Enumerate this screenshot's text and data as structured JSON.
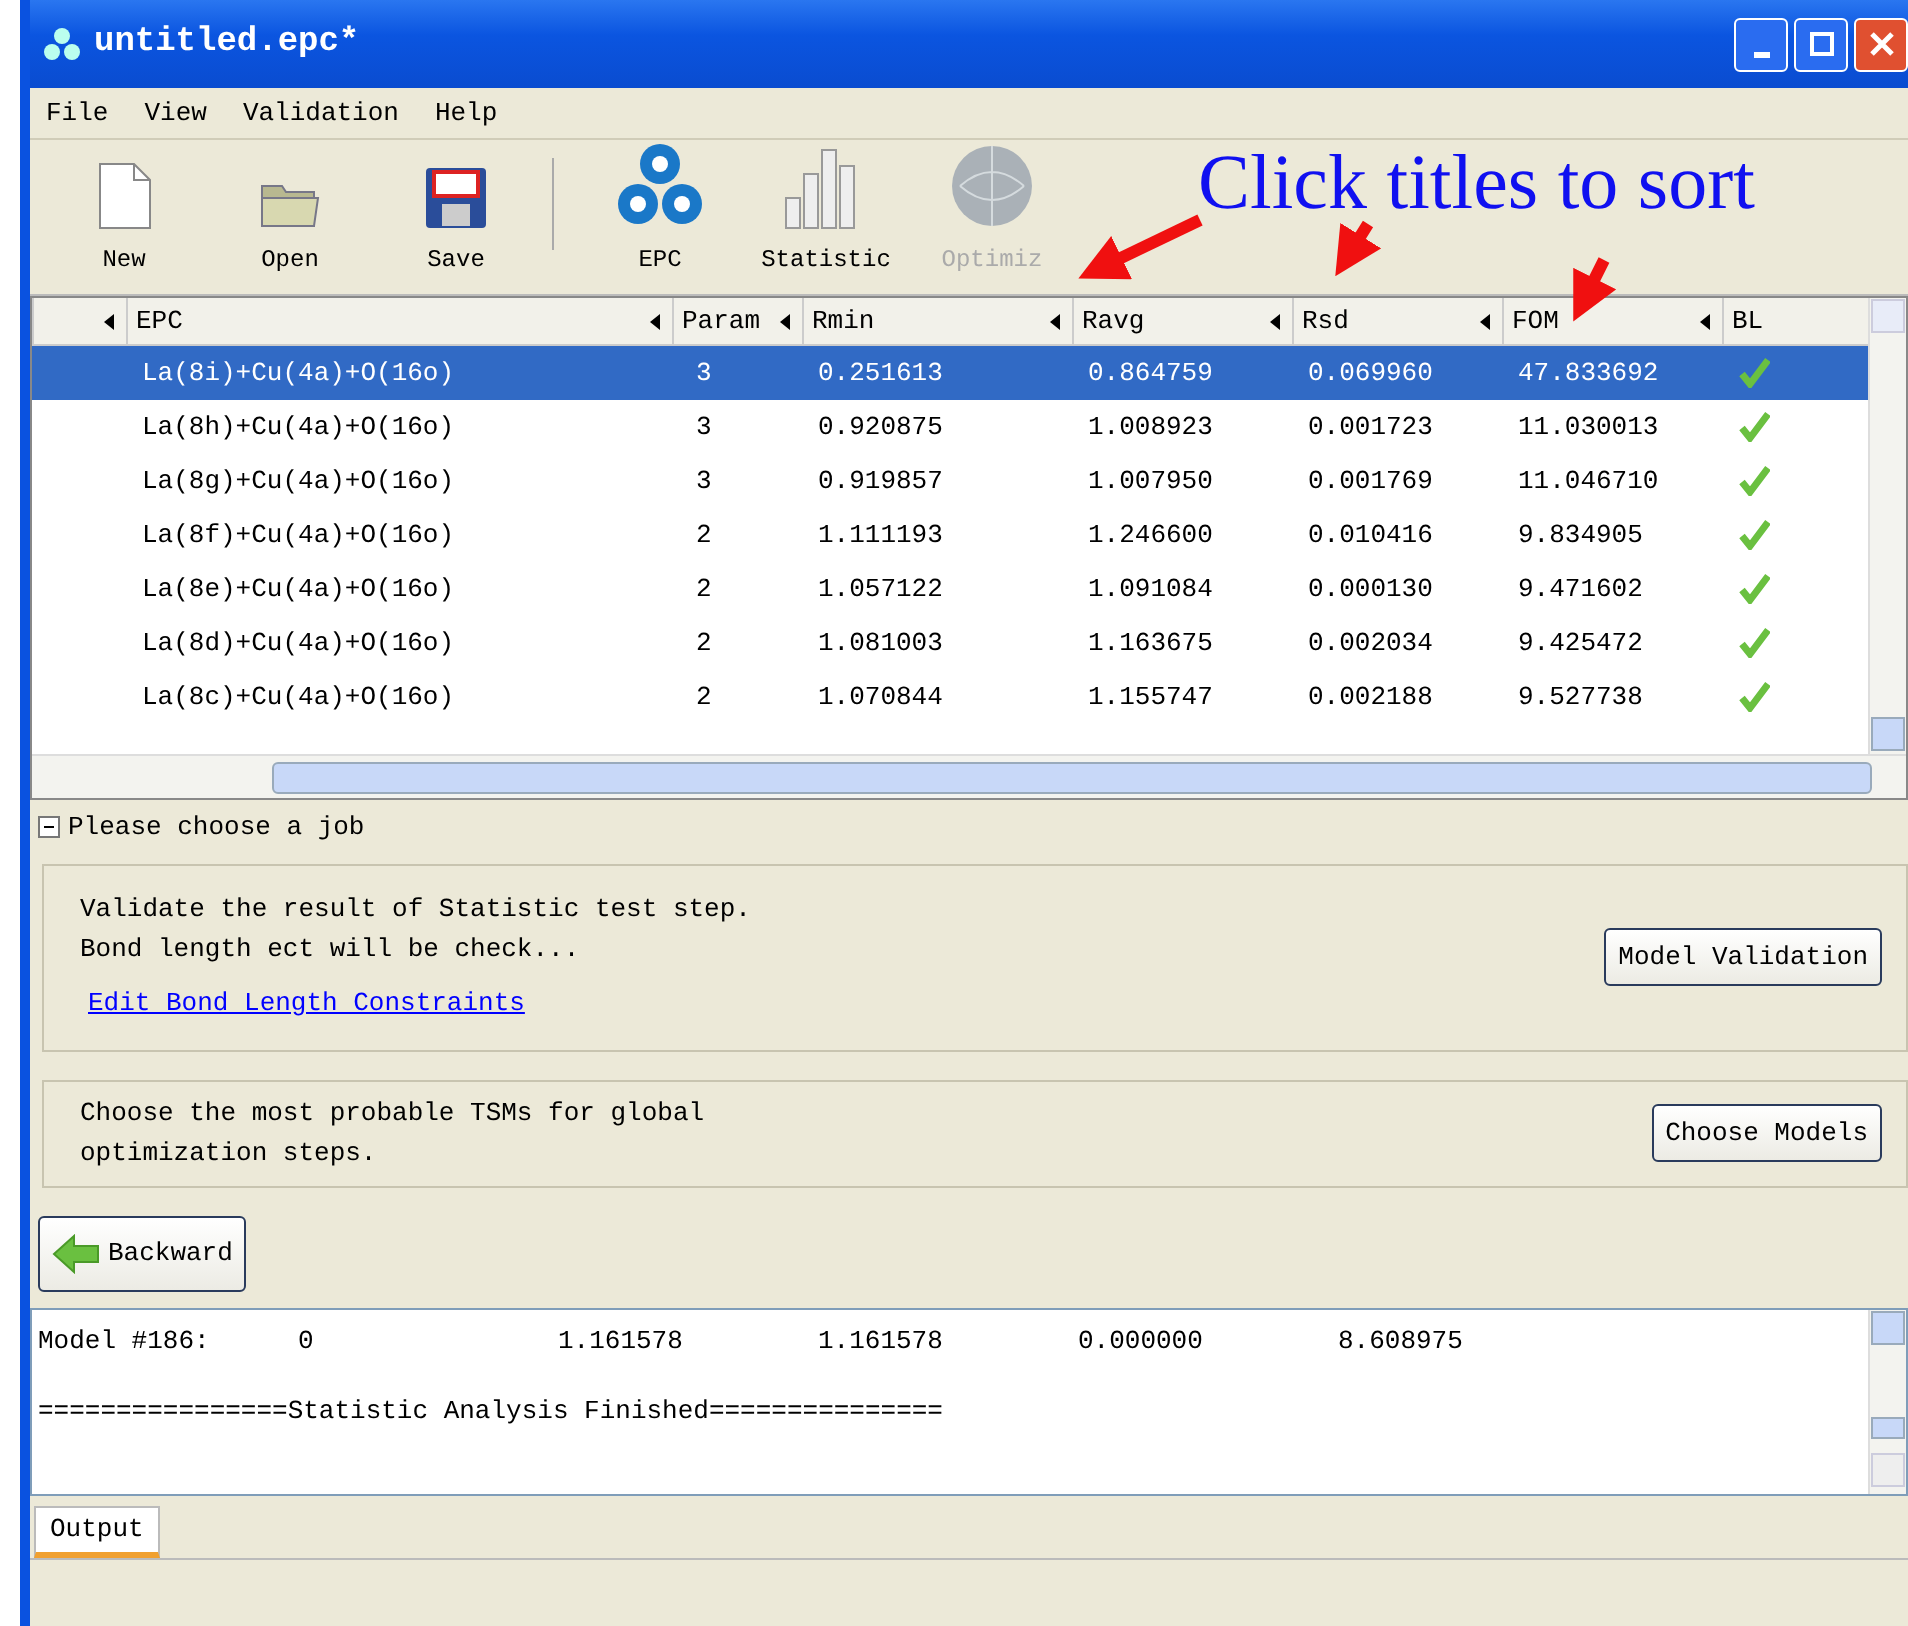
{
  "window": {
    "title": "untitled.epc*"
  },
  "menu": [
    "File",
    "View",
    "Validation",
    "Help"
  ],
  "toolbar": [
    {
      "label": "New",
      "kind": "new",
      "disabled": false
    },
    {
      "label": "Open",
      "kind": "open",
      "disabled": false
    },
    {
      "label": "Save",
      "kind": "save",
      "disabled": false
    },
    {
      "kind": "separator"
    },
    {
      "label": "EPC",
      "kind": "epc",
      "disabled": false
    },
    {
      "label": "Statistic",
      "kind": "statistic",
      "disabled": false
    },
    {
      "label": "Optimiz",
      "kind": "optimization",
      "disabled": true
    }
  ],
  "annotation": {
    "text": "Click titles to sort"
  },
  "table": {
    "columns": [
      "EPC",
      "Param",
      "Rmin",
      "Ravg",
      "Rsd",
      "FOM",
      "BL"
    ],
    "rows": [
      {
        "cells": [
          "La(8i)+Cu(4a)+O(16o)",
          "3",
          "0.251613",
          "0.864759",
          "0.069960",
          "47.833692"
        ],
        "bl": true,
        "selected": true
      },
      {
        "cells": [
          "La(8h)+Cu(4a)+O(16o)",
          "3",
          "0.920875",
          "1.008923",
          "0.001723",
          "11.030013"
        ],
        "bl": true,
        "selected": false
      },
      {
        "cells": [
          "La(8g)+Cu(4a)+O(16o)",
          "3",
          "0.919857",
          "1.007950",
          "0.001769",
          "11.046710"
        ],
        "bl": true,
        "selected": false
      },
      {
        "cells": [
          "La(8f)+Cu(4a)+O(16o)",
          "2",
          "1.111193",
          "1.246600",
          "0.010416",
          "9.834905"
        ],
        "bl": true,
        "selected": false
      },
      {
        "cells": [
          "La(8e)+Cu(4a)+O(16o)",
          "2",
          "1.057122",
          "1.091084",
          "0.000130",
          "9.471602"
        ],
        "bl": true,
        "selected": false
      },
      {
        "cells": [
          "La(8d)+Cu(4a)+O(16o)",
          "2",
          "1.081003",
          "1.163675",
          "0.002034",
          "9.425472"
        ],
        "bl": true,
        "selected": false
      },
      {
        "cells": [
          "La(8c)+Cu(4a)+O(16o)",
          "2",
          "1.070844",
          "1.155747",
          "0.002188",
          "9.527738"
        ],
        "bl": true,
        "selected": false
      }
    ]
  },
  "job_panel": {
    "title": "Please choose a job",
    "expanded": true,
    "jobs": [
      {
        "description": [
          "Validate the result of Statistic test step.",
          "Bond length ect will be check..."
        ],
        "link": "Edit Bond Length Constraints",
        "button": "Model Validation"
      },
      {
        "description": [
          "Choose the most probable TSMs for global",
          "optimization steps."
        ],
        "button": "Choose Models"
      }
    ],
    "back_button": "Backward"
  },
  "output": {
    "lines": [
      {
        "cells": [
          "Model #186:",
          "0",
          "1.161578",
          "1.161578",
          "0.000000",
          "8.608975"
        ]
      },
      {
        "text": "================Statistic Analysis Finished==============="
      }
    ]
  },
  "bottom_tabs": [
    {
      "label": "Output",
      "selected": true
    }
  ]
}
